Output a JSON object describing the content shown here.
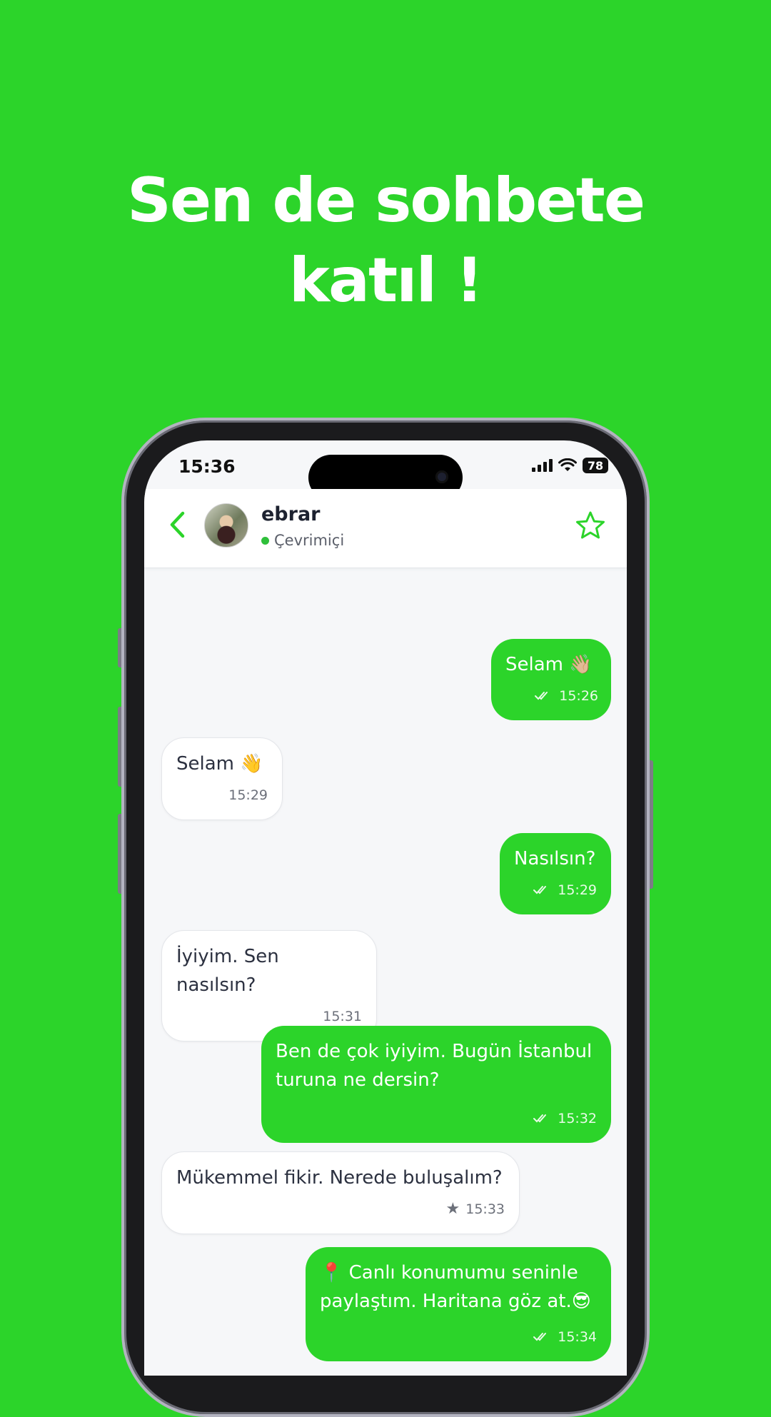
{
  "promo": {
    "headline_line1": "Sen de sohbete",
    "headline_line2": "katıl !"
  },
  "status_bar": {
    "time": "15:36",
    "battery": "78"
  },
  "chat_header": {
    "name": "ebrar",
    "presence": "Çevrimiçi"
  },
  "messages": [
    {
      "direction": "out",
      "text": "Selam 👋🏼",
      "time": "15:26",
      "status": "read"
    },
    {
      "direction": "in",
      "text": "Selam 👋",
      "time": "15:29"
    },
    {
      "direction": "out",
      "text": "Nasılsın?",
      "time": "15:29",
      "status": "read"
    },
    {
      "direction": "in",
      "text": "İyiyim. Sen nasılsın?",
      "time": "15:31"
    },
    {
      "direction": "out",
      "text": "Ben de çok iyiyim. Bugün İstanbul turuna ne dersin?",
      "time": "15:32",
      "status": "read"
    },
    {
      "direction": "in",
      "text": "Mükemmel fikir. Nerede buluşalım?",
      "time": "15:33",
      "starred": true
    },
    {
      "direction": "out",
      "text": "📍 Canlı konumumu seninle paylaştım. Haritana göz at.😎",
      "time": "15:34",
      "status": "read"
    }
  ],
  "colors": {
    "brand_green": "#2cd42a",
    "chat_background": "#f6f7f9"
  }
}
